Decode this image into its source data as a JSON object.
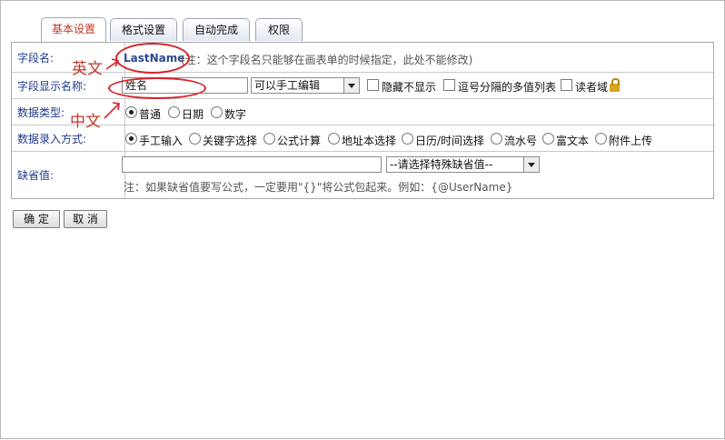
{
  "tabs": [
    {
      "label": "基本设置",
      "active": true
    },
    {
      "label": "格式设置",
      "active": false
    },
    {
      "label": "自动完成",
      "active": false
    },
    {
      "label": "权限",
      "active": false
    }
  ],
  "rows": {
    "field_name": {
      "label": "字段名:",
      "value": "LastName",
      "note": "(注：这个字段名只能够在画表单的时候指定，此处不能修改)"
    },
    "display_name": {
      "label": "字段显示名称:",
      "value": "姓名",
      "edit_mode_selected": "可以手工编辑",
      "hide_label": "隐藏不显示",
      "multi_value_label": "逗号分隔的多值列表",
      "reader_label": "读者域"
    },
    "data_type": {
      "label": "数据类型:",
      "options": [
        "普通",
        "日期",
        "数字"
      ],
      "selected": "普通"
    },
    "entry_method": {
      "label": "数据录入方式:",
      "options": [
        "手工输入",
        "关键字选择",
        "公式计算",
        "地址本选择",
        "日历/时间选择",
        "流水号",
        "富文本",
        "附件上传"
      ],
      "selected": "手工输入"
    },
    "default_value": {
      "label": "缺省值:",
      "value": "",
      "special_select": "--请选择特殊缺省值--",
      "note": "注：如果缺省值要写公式，一定要用\"{}\"将公式包起来。例如：{@UserName}"
    }
  },
  "buttons": {
    "ok": "确 定",
    "cancel": "取 消"
  },
  "annotations": {
    "english": "英文",
    "chinese": "中文"
  },
  "colors": {
    "annotation_red": "#d8202a",
    "label_blue": "#1f3a8a",
    "active_tab_text": "#c0392b"
  }
}
